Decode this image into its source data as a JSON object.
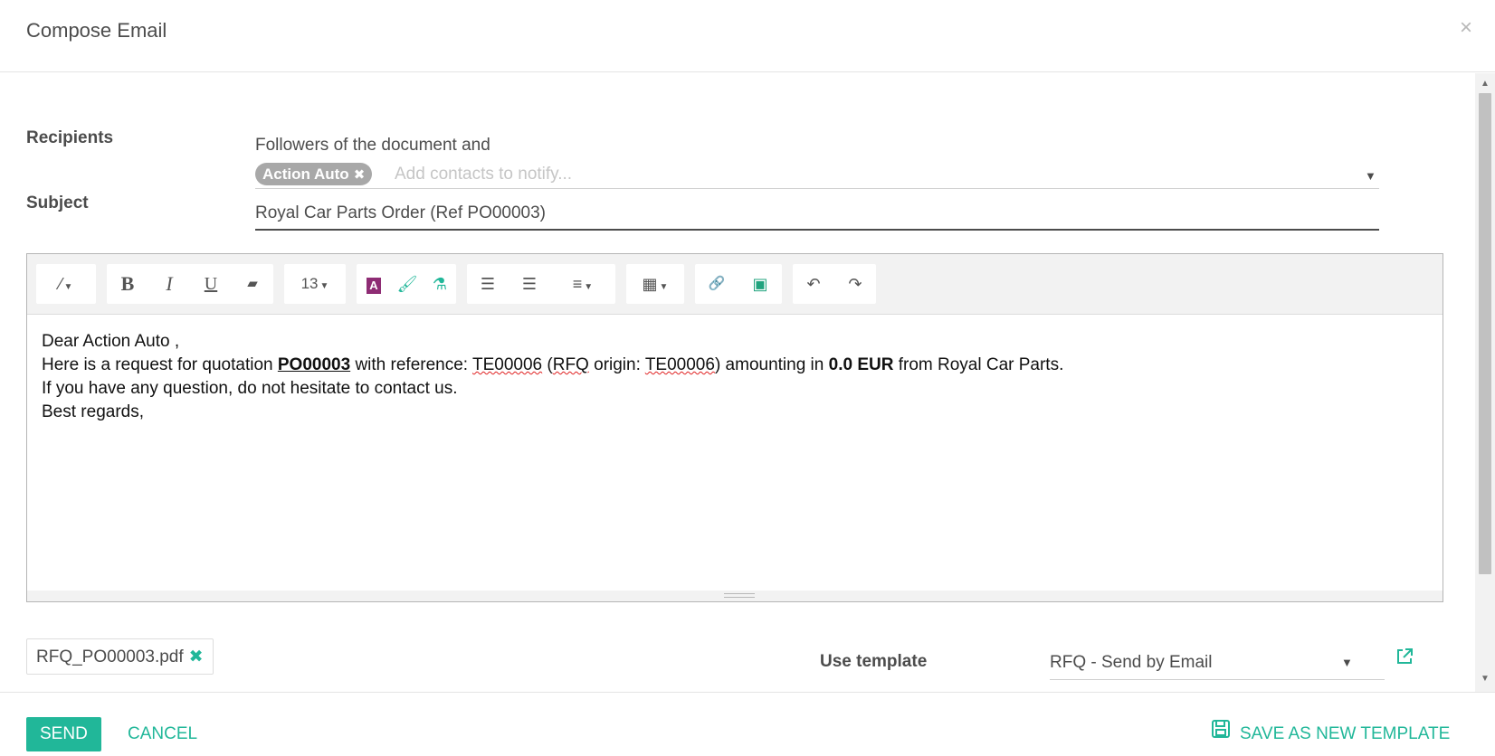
{
  "dialog": {
    "title": "Compose Email",
    "close_icon": "×"
  },
  "form": {
    "recipients_label": "Recipients",
    "recipients_prefix": "Followers of the document and",
    "recipient_tags": [
      {
        "label": "Action Auto",
        "remove_icon": "✖"
      }
    ],
    "recipients_placeholder": "Add contacts to notify...",
    "subject_label": "Subject",
    "subject_value": "Royal Car Parts Order (Ref PO00003)"
  },
  "toolbar": {
    "style_icon": "⁄",
    "bold": "B",
    "italic": "I",
    "underline": "U",
    "eraser_icon": "▰",
    "font_size": "13",
    "font_color_icon": "A",
    "brush_icon": "🖌",
    "flask_icon": "⚗",
    "ul_icon": "☰",
    "ol_icon": "☰",
    "align_icon": "≡",
    "table_icon": "▦",
    "link_icon": "🔗",
    "image_icon": "▣",
    "undo_icon": "↶",
    "redo_icon": "↷"
  },
  "body": {
    "line1": "Dear Action Auto ,",
    "line2_a": "Here is a request for quotation ",
    "line2_po": "PO00003",
    "line2_b": " with reference: ",
    "line2_ref": "TE00006",
    "line2_c": " (",
    "line2_rfq": "RFQ",
    "line2_d": " origin: ",
    "line2_origin": "TE00006",
    "line2_e": ") amounting in ",
    "line2_amount": "0.0 EUR",
    "line2_f": " from Royal Car Parts.",
    "line3": "If you have any question, do not hesitate to contact us.",
    "line4": "Best regards,"
  },
  "attachment": {
    "filename": "RFQ_PO00003.pdf",
    "remove_icon": "✖"
  },
  "template": {
    "label": "Use template",
    "value": "RFQ - Send by Email"
  },
  "footer": {
    "send": "SEND",
    "cancel": "CANCEL",
    "save_template": "SAVE AS NEW TEMPLATE"
  },
  "colors": {
    "accent": "#21b799",
    "tag_bg": "#a8a8a8",
    "text": "#4c4c4c"
  }
}
